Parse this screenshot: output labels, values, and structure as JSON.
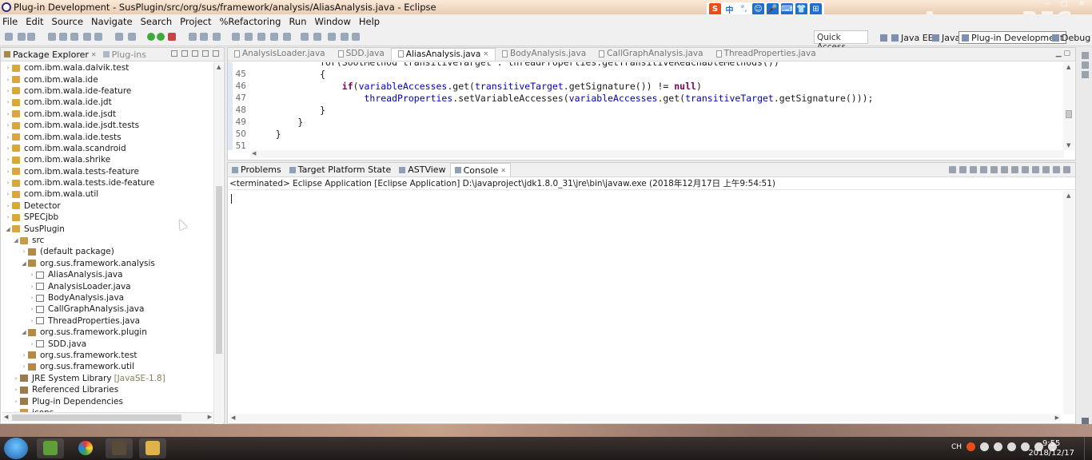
{
  "window": {
    "title": "Plug-in Development - SusPlugin/src/org/sus/framework/analysis/AliasAnalysis.java - Eclipse",
    "watermark": "ApowerREC"
  },
  "ime": {
    "items": [
      "S",
      "中",
      "°,",
      "☺",
      "🎤",
      "⌨",
      "👕",
      "⊞"
    ]
  },
  "menu": [
    "File",
    "Edit",
    "Source",
    "Navigate",
    "Search",
    "Project",
    "%Refactoring",
    "Run",
    "Window",
    "Help"
  ],
  "toolbar": {
    "quick_access_placeholder": "Quick Access",
    "perspectives": [
      {
        "label": "Java EE",
        "active": false
      },
      {
        "label": "Java",
        "active": false
      },
      {
        "label": "Plug-in Development",
        "active": true
      },
      {
        "label": "Debug",
        "active": false
      }
    ]
  },
  "package_explorer": {
    "tabs": [
      {
        "label": "Package Explorer",
        "active": true
      },
      {
        "label": "Plug-ins",
        "active": false
      }
    ],
    "tree": [
      {
        "label": "com.ibm.wala.dalvik.test",
        "depth": 0,
        "icon": "project",
        "arrow": "›"
      },
      {
        "label": "com.ibm.wala.ide",
        "depth": 0,
        "icon": "project",
        "arrow": "›"
      },
      {
        "label": "com.ibm.wala.ide-feature",
        "depth": 0,
        "icon": "project",
        "arrow": "›"
      },
      {
        "label": "com.ibm.wala.ide.jdt",
        "depth": 0,
        "icon": "project",
        "arrow": "›"
      },
      {
        "label": "com.ibm.wala.ide.jsdt",
        "depth": 0,
        "icon": "project",
        "arrow": "›"
      },
      {
        "label": "com.ibm.wala.ide.jsdt.tests",
        "depth": 0,
        "icon": "project",
        "arrow": "›"
      },
      {
        "label": "com.ibm.wala.ide.tests",
        "depth": 0,
        "icon": "project",
        "arrow": "›"
      },
      {
        "label": "com.ibm.wala.scandroid",
        "depth": 0,
        "icon": "project",
        "arrow": "›"
      },
      {
        "label": "com.ibm.wala.shrike",
        "depth": 0,
        "icon": "project",
        "arrow": "›"
      },
      {
        "label": "com.ibm.wala.tests-feature",
        "depth": 0,
        "icon": "project",
        "arrow": "›"
      },
      {
        "label": "com.ibm.wala.tests.ide-feature",
        "depth": 0,
        "icon": "project",
        "arrow": "›"
      },
      {
        "label": "com.ibm.wala.util",
        "depth": 0,
        "icon": "project",
        "arrow": "›"
      },
      {
        "label": "Detector",
        "depth": 0,
        "icon": "project",
        "arrow": "›"
      },
      {
        "label": "SPECjbb",
        "depth": 0,
        "icon": "project",
        "arrow": "›"
      },
      {
        "label": "SusPlugin",
        "depth": 0,
        "icon": "project",
        "arrow": "◢"
      },
      {
        "label": "src",
        "depth": 1,
        "icon": "src",
        "arrow": "◢"
      },
      {
        "label": "(default package)",
        "depth": 2,
        "icon": "package",
        "arrow": "›"
      },
      {
        "label": "org.sus.framework.analysis",
        "depth": 2,
        "icon": "package",
        "arrow": "◢"
      },
      {
        "label": "AliasAnalysis.java",
        "depth": 3,
        "icon": "java",
        "arrow": "›"
      },
      {
        "label": "AnalysisLoader.java",
        "depth": 3,
        "icon": "java",
        "arrow": "›"
      },
      {
        "label": "BodyAnalysis.java",
        "depth": 3,
        "icon": "java",
        "arrow": "›"
      },
      {
        "label": "CallGraphAnalysis.java",
        "depth": 3,
        "icon": "java",
        "arrow": "›"
      },
      {
        "label": "ThreadProperties.java",
        "depth": 3,
        "icon": "java",
        "arrow": "›"
      },
      {
        "label": "org.sus.framework.plugin",
        "depth": 2,
        "icon": "package",
        "arrow": "◢"
      },
      {
        "label": "SDD.java",
        "depth": 3,
        "icon": "java",
        "arrow": "›"
      },
      {
        "label": "org.sus.framework.test",
        "depth": 2,
        "icon": "package",
        "arrow": "›"
      },
      {
        "label": "org.sus.framework.util",
        "depth": 2,
        "icon": "package",
        "arrow": "›"
      },
      {
        "label": "JRE System Library",
        "depth": 1,
        "icon": "library",
        "arrow": "›",
        "extra": "[JavaSE-1.8]"
      },
      {
        "label": "Referenced Libraries",
        "depth": 1,
        "icon": "library",
        "arrow": "›"
      },
      {
        "label": "Plug-in Dependencies",
        "depth": 1,
        "icon": "library",
        "arrow": "›"
      },
      {
        "label": "icons",
        "depth": 1,
        "icon": "src",
        "arrow": "›"
      }
    ]
  },
  "editor": {
    "tabs": [
      {
        "label": "AnalysisLoader.java",
        "active": false
      },
      {
        "label": "SDD.java",
        "active": false
      },
      {
        "label": "AliasAnalysis.java",
        "active": true
      },
      {
        "label": "BodyAnalysis.java",
        "active": false
      },
      {
        "label": "CallGraphAnalysis.java",
        "active": false
      },
      {
        "label": "ThreadProperties.java",
        "active": false
      }
    ],
    "partial_line": "            for(SootMethod transitiveTarget : threadProperties.getTransitiveReachableMethods())",
    "lines": [
      {
        "num": "45",
        "segments": [
          {
            "t": "            {",
            "c": "plain"
          }
        ]
      },
      {
        "num": "46",
        "segments": [
          {
            "t": "                ",
            "c": "plain"
          },
          {
            "t": "if",
            "c": "kw"
          },
          {
            "t": "(",
            "c": "plain"
          },
          {
            "t": "variableAccesses",
            "c": "fld"
          },
          {
            "t": ".get(",
            "c": "plain"
          },
          {
            "t": "transitiveTarget",
            "c": "fld"
          },
          {
            "t": ".getSignature()) != ",
            "c": "plain"
          },
          {
            "t": "null",
            "c": "kw"
          },
          {
            "t": ")",
            "c": "plain"
          }
        ]
      },
      {
        "num": "47",
        "segments": [
          {
            "t": "                    ",
            "c": "plain"
          },
          {
            "t": "threadProperties",
            "c": "fld"
          },
          {
            "t": ".setVariableAccesses(",
            "c": "plain"
          },
          {
            "t": "variableAccesses",
            "c": "fld"
          },
          {
            "t": ".get(",
            "c": "plain"
          },
          {
            "t": "transitiveTarget",
            "c": "fld"
          },
          {
            "t": ".getSignature()));",
            "c": "plain"
          }
        ]
      },
      {
        "num": "48",
        "segments": [
          {
            "t": "            }",
            "c": "plain"
          }
        ]
      },
      {
        "num": "49",
        "segments": [
          {
            "t": "        }",
            "c": "plain"
          }
        ]
      },
      {
        "num": "50",
        "segments": [
          {
            "t": "    }",
            "c": "plain"
          }
        ]
      },
      {
        "num": "51",
        "segments": [
          {
            "t": "",
            "c": "plain"
          }
        ]
      }
    ]
  },
  "console": {
    "tabs": [
      {
        "label": "Problems",
        "active": false
      },
      {
        "label": "Target Platform State",
        "active": false
      },
      {
        "label": "ASTView",
        "active": false
      },
      {
        "label": "Console",
        "active": true
      }
    ],
    "status": "<terminated> Eclipse Application [Eclipse Application] D:\\javaproject\\jdk1.8.0_31\\jre\\bin\\javaw.exe (2018年12月17日 上午9:54:51)"
  },
  "taskbar": {
    "tray_lang": "CH",
    "clock_time": "9:55",
    "clock_date": "2018/12/17"
  }
}
